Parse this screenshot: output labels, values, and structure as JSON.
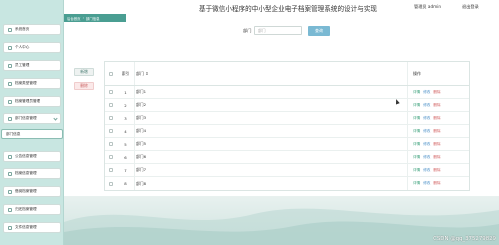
{
  "header": {
    "title": "基于微信小程序的中小型企业电子档案管理系统的设计与实现",
    "user_name": "管理员 admin",
    "logout_label": "退出登录"
  },
  "breadcrumb": [
    "后台首页",
    "部门信息"
  ],
  "sidebar": {
    "items": [
      {
        "label": "系统首页"
      },
      {
        "label": "个人中心"
      },
      {
        "label": "员工管理"
      },
      {
        "label": "档案类型管理"
      },
      {
        "label": "档案管理员管理"
      },
      {
        "label": "部门信息管理",
        "expanded": true
      },
      {
        "label": "部门信息",
        "sub": true,
        "active": true
      },
      {
        "label": "公告信息管理"
      },
      {
        "label": "档案信息管理"
      },
      {
        "label": "借阅档案管理"
      },
      {
        "label": "归还档案管理"
      },
      {
        "label": "文件信息管理"
      }
    ]
  },
  "search": {
    "label": "部门",
    "placeholder": "部门",
    "button_label": "查询"
  },
  "actions": {
    "add_label": "新增",
    "delete_label": "删除"
  },
  "table": {
    "index_header": "索引",
    "dept_header": "部门",
    "ops_header": "操作",
    "rows": [
      {
        "index": "1",
        "dept": "部门1"
      },
      {
        "index": "2",
        "dept": "部门2"
      },
      {
        "index": "3",
        "dept": "部门3"
      },
      {
        "index": "4",
        "dept": "部门4"
      },
      {
        "index": "5",
        "dept": "部门5"
      },
      {
        "index": "6",
        "dept": "部门6"
      },
      {
        "index": "7",
        "dept": "部门7"
      },
      {
        "index": "8",
        "dept": "部门8"
      }
    ],
    "op_detail": "详情",
    "op_edit": "修改",
    "op_delete": "删除"
  },
  "watermark": "CSDN @qq_375279829",
  "colors": {
    "sidebar_bg": "#c8e6e1",
    "accent": "#4a9e92",
    "search_button": "#7ab9d3",
    "detail": "#3aa07a",
    "edit": "#4a8fc7",
    "delete": "#d05a5a"
  }
}
